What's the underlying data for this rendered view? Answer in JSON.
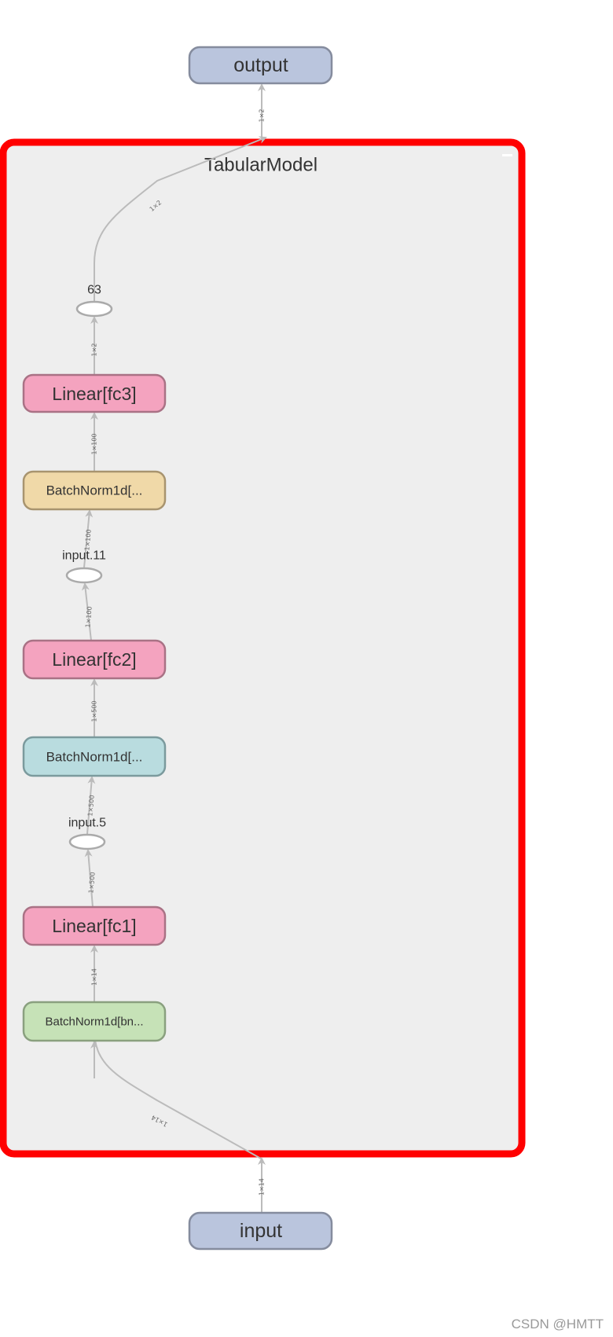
{
  "graph": {
    "group": {
      "title": "TabularModel",
      "highlight_color": "#ff0000"
    },
    "nodes": {
      "output": {
        "label": "output",
        "color": "#bac5dd"
      },
      "op63": {
        "label": "63"
      },
      "fc3": {
        "label": "Linear[fc3]",
        "color": "#f4a3bf"
      },
      "bn2": {
        "label": "BatchNorm1d[...",
        "color": "#f0d9a8"
      },
      "input11": {
        "label": "input.11"
      },
      "fc2": {
        "label": "Linear[fc2]",
        "color": "#f4a3bf"
      },
      "bn1": {
        "label": "BatchNorm1d[...",
        "color": "#b9dcdf"
      },
      "input5": {
        "label": "input.5"
      },
      "fc1": {
        "label": "Linear[fc1]",
        "color": "#f4a3bf"
      },
      "bn_cont": {
        "label": "BatchNorm1d[bn...",
        "color": "#c6e2b7"
      },
      "input": {
        "label": "input",
        "color": "#bac5dd"
      }
    },
    "edges": {
      "group_to_output": "1×2",
      "op63_to_group": "1×2",
      "fc3_to_op63": "1×2",
      "bn2_to_fc3": "1×100",
      "input11_to_bn2": "1×100",
      "fc2_to_input11": "1×100",
      "bn1_to_fc2": "1×500",
      "input5_to_bn1": "1×500",
      "fc1_to_input5": "1×500",
      "bncont_to_fc1": "1×14",
      "group_to_bncont": "1×14",
      "input_to_group": "1×14"
    }
  },
  "watermark": "CSDN @HMTT"
}
